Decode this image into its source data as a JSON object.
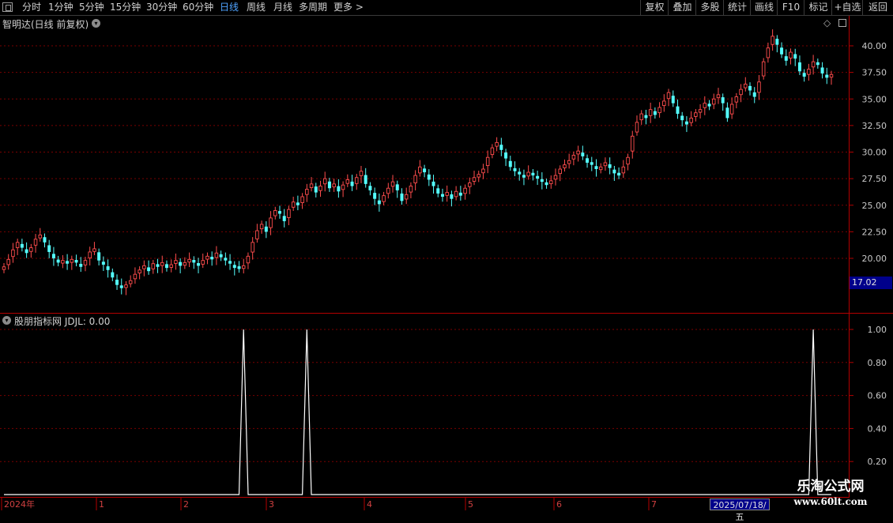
{
  "toolbar": {
    "periods": [
      "分时",
      "1分钟",
      "5分钟",
      "15分钟",
      "30分钟",
      "60分钟",
      "日线",
      "周线",
      "月线",
      "多周期",
      "更多 >"
    ],
    "active_period": "日线",
    "right_buttons": [
      "复权",
      "叠加",
      "多股",
      "统计",
      "画线",
      "F10",
      "标记",
      "+自选",
      "返回"
    ]
  },
  "main_chart": {
    "title": "智明达(日线 前复权)",
    "y_ticks": [
      "40.00",
      "37.50",
      "35.00",
      "32.50",
      "30.00",
      "27.50",
      "25.00",
      "22.50",
      "20.00"
    ],
    "current_price": "17.02"
  },
  "indicator": {
    "title": "股朋指标网 JDJL: 0.00",
    "y_ticks": [
      "1.00",
      "0.80",
      "0.60",
      "0.40",
      "0.20"
    ]
  },
  "x_axis": {
    "labels": [
      "2024年",
      "1",
      "2",
      "3",
      "4",
      "5",
      "6",
      "7"
    ],
    "selected_date": "2025/07/18/五"
  },
  "watermark": {
    "name": "乐淘公式网",
    "url": "www.60lt.com"
  },
  "colors": {
    "up": "#ff4d4d",
    "down": "#54ffff",
    "grid": "#7a0000",
    "axis": "#b40000",
    "active": "#4fa3ff"
  },
  "chart_data": [
    {
      "type": "candlestick",
      "title": "智明达(日线 前复权)",
      "ylim": [
        16.5,
        41.8
      ],
      "closes": [
        19.2,
        19.9,
        20.8,
        21.5,
        21.0,
        20.5,
        21.0,
        21.8,
        22.2,
        21.5,
        20.6,
        20.0,
        19.6,
        19.8,
        19.5,
        19.9,
        19.6,
        19.2,
        19.8,
        20.6,
        20.9,
        19.8,
        19.4,
        18.9,
        18.2,
        17.5,
        17.2,
        17.5,
        17.9,
        18.5,
        18.9,
        19.3,
        18.8,
        19.5,
        19.2,
        19.6,
        19.1,
        19.4,
        19.8,
        19.3,
        19.6,
        19.9,
        19.6,
        19.3,
        19.8,
        20.2,
        19.9,
        20.5,
        20.1,
        19.8,
        19.5,
        19.1,
        19.0,
        19.3,
        20.2,
        21.5,
        22.6,
        23.2,
        22.5,
        23.8,
        24.5,
        24.2,
        23.5,
        24.6,
        25.3,
        25.0,
        25.8,
        26.5,
        27.0,
        26.2,
        26.8,
        27.5,
        26.6,
        27.0,
        26.3,
        26.9,
        27.4,
        26.8,
        27.6,
        28.2,
        27.0,
        26.4,
        25.6,
        25.1,
        25.9,
        26.6,
        27.2,
        26.4,
        25.4,
        26.0,
        26.8,
        27.8,
        28.6,
        28.1,
        27.4,
        26.8,
        26.1,
        25.8,
        26.2,
        25.6,
        26.3,
        25.9,
        26.6,
        27.1,
        27.6,
        27.9,
        28.4,
        29.5,
        30.4,
        30.9,
        30.2,
        29.4,
        28.6,
        28.2,
        27.9,
        27.6,
        28.1,
        27.8,
        27.5,
        27.2,
        26.9,
        27.3,
        27.8,
        28.4,
        28.8,
        29.2,
        29.7,
        30.1,
        29.6,
        29.0,
        28.8,
        28.4,
        28.6,
        29.0,
        28.5,
        28.0,
        27.8,
        28.6,
        29.5,
        31.5,
        32.8,
        33.6,
        33.2,
        34.0,
        33.5,
        34.2,
        34.8,
        35.6,
        34.6,
        33.6,
        33.0,
        32.6,
        33.2,
        33.7,
        34.0,
        34.6,
        34.3,
        35.0,
        35.4,
        34.6,
        33.2,
        34.5,
        35.2,
        35.9,
        36.4,
        35.8,
        35.2,
        36.6,
        38.5,
        39.8,
        40.9,
        40.1,
        39.2,
        38.6,
        39.4,
        38.8,
        37.6,
        37.1,
        37.8,
        38.5,
        38.2,
        37.4,
        37.0,
        37.3
      ]
    },
    {
      "type": "line",
      "title": "股朋指标网 JDJL: 0.00",
      "ylim": [
        0,
        1.05
      ],
      "series": [
        {
          "name": "JDJL",
          "nonzero_points": [
            {
              "index": 53,
              "value": 1.0
            },
            {
              "index": 67,
              "value": 1.0
            },
            {
              "index": 179,
              "value": 1.0
            }
          ]
        }
      ]
    }
  ]
}
